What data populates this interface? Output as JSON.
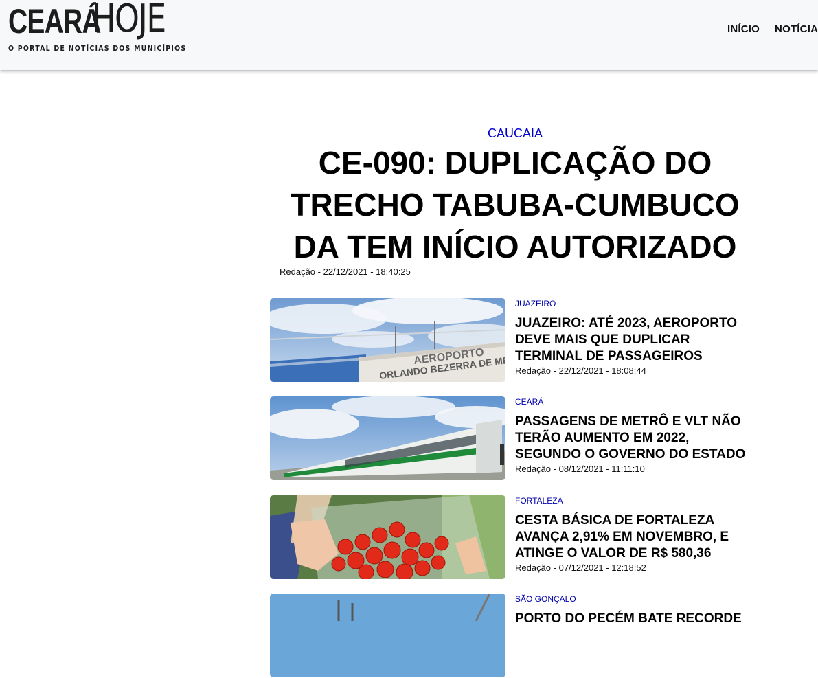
{
  "header": {
    "logo_main_left": "CEARÁ",
    "logo_main_right": "HOJE",
    "logo_tagline": "O PORTAL DE NOTÍCIAS DOS MUNICÍPIOS",
    "nav": [
      {
        "label": "INÍCIO"
      },
      {
        "label": "NOTÍCIAS"
      }
    ]
  },
  "featured": {
    "category": "CAUCAIA",
    "title": "CE-090: DUPLICAÇÃO DO TRECHO TABUBA-CUMBUCO DA TEM INÍCIO AUTORIZADO",
    "meta": "Redação - 22/12/2021 - 18:40:25"
  },
  "news": [
    {
      "category": "JUAZEIRO",
      "title": "JUAZEIRO: ATÉ 2023, AEROPORTO DEVE MAIS QUE DUPLICAR TERMINAL DE PASSAGEIROS",
      "meta": "Redação - 22/12/2021 - 18:08:44",
      "image_sign_line1": "AEROPORTO",
      "image_sign_line2": "ORLANDO BEZERRA DE MENEZES"
    },
    {
      "category": "CEARÁ",
      "title": "PASSAGENS DE METRÔ E VLT NÃO TERÃO AUMENTO EM 2022, SEGUNDO O GOVERNO DO ESTADO",
      "meta": "Redação - 08/12/2021 - 11:11:10"
    },
    {
      "category": "FORTALEZA",
      "title": "CESTA BÁSICA DE FORTALEZA AVANÇA 2,91% EM NOVEMBRO, E ATINGE O VALOR DE R$ 580,36",
      "meta": "Redação - 07/12/2021 - 12:18:52"
    },
    {
      "category": "SÃO GONÇALO",
      "title": "PORTO DO PECÉM BATE RECORDE",
      "meta": ""
    }
  ],
  "colors": {
    "category_link": "#0000cc",
    "header_bg": "#f7f8f9",
    "text": "#000000"
  }
}
